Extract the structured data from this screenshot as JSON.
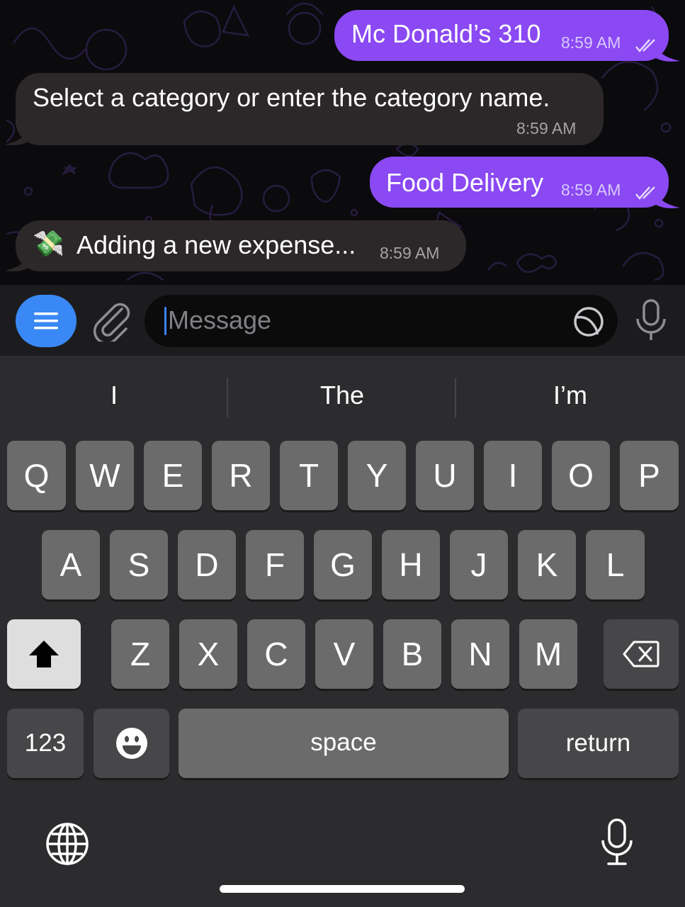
{
  "messages": [
    {
      "dir": "out",
      "text": "Mc Donald’s 310",
      "time": "8:59 AM",
      "read": true
    },
    {
      "dir": "in",
      "text": "Select a category or enter the category name.",
      "time": "8:59 AM"
    },
    {
      "dir": "out",
      "text": "Food Delivery",
      "time": "8:59 AM",
      "read": true
    },
    {
      "dir": "in",
      "emoji": "💸",
      "text": "Adding a new expense...",
      "time": "8:59 AM"
    }
  ],
  "input": {
    "placeholder": "Message",
    "menu_icon": "hamburger-menu-icon",
    "attach_icon": "paperclip-icon",
    "sticker_icon": "sticker-icon",
    "mic_icon": "microphone-icon"
  },
  "keyboard": {
    "suggestions": [
      "I",
      "The",
      "I’m"
    ],
    "row1": [
      "Q",
      "W",
      "E",
      "R",
      "T",
      "Y",
      "U",
      "I",
      "O",
      "P"
    ],
    "row2": [
      "A",
      "S",
      "D",
      "F",
      "G",
      "H",
      "J",
      "K",
      "L"
    ],
    "row3": [
      "Z",
      "X",
      "C",
      "V",
      "B",
      "N",
      "M"
    ],
    "numbers_label": "123",
    "space_label": "space",
    "return_label": "return",
    "icons": [
      "shift-icon",
      "backspace-icon",
      "emoji-icon",
      "globe-icon",
      "dictation-icon"
    ]
  },
  "colors": {
    "outgoing_bubble": "#8a49f2",
    "incoming_bubble": "#2c2829",
    "menu_button": "#3a88f5",
    "keyboard_bg": "#2c2c2e"
  }
}
